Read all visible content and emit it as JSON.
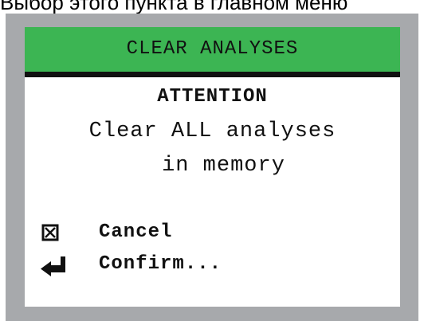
{
  "caption": "Выбор этого пункта в главном меню",
  "dialog": {
    "title": "CLEAR ANALYSES",
    "heading": "ATTENTION",
    "message_line1": "Clear ALL analyses",
    "message_line2": "in memory"
  },
  "options": [
    {
      "label": "Cancel",
      "icon": "checkbox-x-icon"
    },
    {
      "label": "Confirm...",
      "icon": "enter-arrow-icon"
    }
  ],
  "colors": {
    "title_bar": "#3cb553",
    "bezel": "#a7a9ac",
    "text": "#111111"
  }
}
